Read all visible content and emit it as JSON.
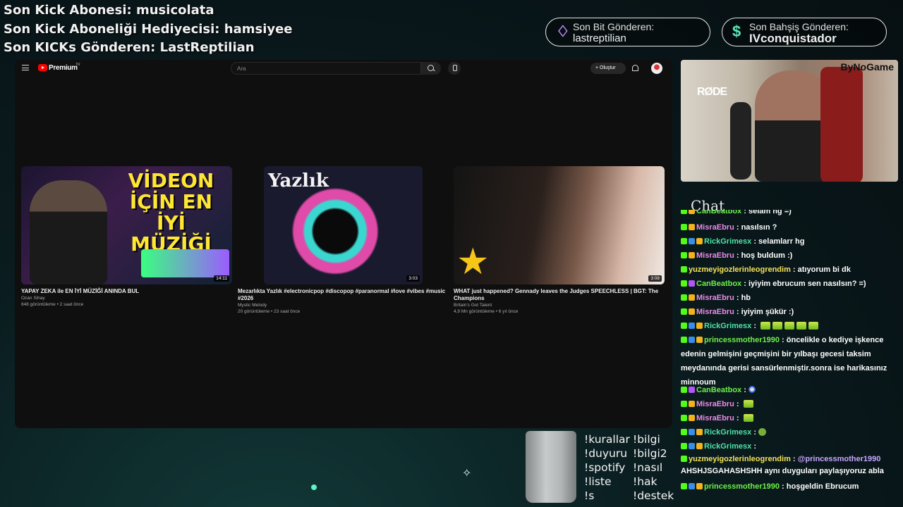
{
  "overlay": {
    "lines": [
      "Son Kick Abonesi: musicolata",
      "Son Kick Aboneliği Hediyecisi: hamsiyee",
      "Son KICKs Gönderen: LastReptilian"
    ],
    "bits": {
      "label": "Son Bit Gönderen:",
      "value": "lastreptilian",
      "icon": "♢"
    },
    "bet": {
      "label": "Son Bahşiş Gönderen:",
      "value": "IVconquistador",
      "icon": "$"
    }
  },
  "youtube": {
    "logo": "Premium",
    "logo_sup": "TR",
    "search_placeholder": "Ara",
    "create_label": "Oluştur",
    "videos": [
      {
        "title": "YAPAY ZEKA ile EN İYİ MÜZİĞİ ANINDA BUL",
        "thumb_text": "VİDEON İÇİN EN İYİ MÜZİĞİ BUL",
        "channel": "Ozan Sihay",
        "meta": "848 görüntüleme • 2 saat önce",
        "duration": "14:11"
      },
      {
        "title": "Mezarlıkta Yazlık #electronicpop #discopop #paranormal #love #vibes #music #2026",
        "thumb_text": "Yazlık",
        "channel": "Mystic Melody",
        "meta": "20 görüntüleme • 23 saat önce",
        "duration": "3:03"
      },
      {
        "title": "WHAT just happened? Gennady leaves the Judges SPEECHLESS | BGT: The Champions",
        "channel": "Britain's Got Talent",
        "meta": "4,9 Mn görüntüleme • 6 yıl önce",
        "duration": "3:08"
      }
    ]
  },
  "webcam": {
    "brand": "ByNoGame",
    "mic_brand": "RØDE"
  },
  "chat": {
    "title": "Chat",
    "messages": [
      {
        "user": "CanBeatbox",
        "text": "selam hg =)"
      },
      {
        "user": "MisraEbru",
        "text": "nasılsın ?"
      },
      {
        "user": "RickGrimesx",
        "text": "selamlarr hg"
      },
      {
        "user": "MisraEbru",
        "text": "hoş buldum :)"
      },
      {
        "user": "yuzmeyigozlerinleogrendim",
        "text": "atıyorum bi dk"
      },
      {
        "user": "CanBeatbox",
        "text": "iyiyim ebrucum sen nasılsın? =)"
      },
      {
        "user": "MisraEbru",
        "text": "hb"
      },
      {
        "user": "MisraEbru",
        "text": "iyiyim şükür :)"
      },
      {
        "user": "RickGrimesx",
        "text": ""
      },
      {
        "user": "princessmother1990",
        "text": "öncelikle o kediye işkence edenin gelmişini geçmişini bir yılbaşı gecesi taksim meydanında gerisi sansürlenmiştir.sonra ise harikasınız minnoum"
      },
      {
        "user": "CanBeatbox",
        "text": ""
      },
      {
        "user": "MisraEbru",
        "text": ""
      },
      {
        "user": "MisraEbru",
        "text": ""
      },
      {
        "user": "RickGrimesx",
        "text": ""
      },
      {
        "user": "RickGrimesx",
        "text": ""
      },
      {
        "user": "yuzmeyigozlerinleogrendim",
        "text": "AHSHJSGAHASHSHH aynı duyguları paylaşıyoruz abla",
        "mention": "@princessmother1990"
      },
      {
        "user": "princessmother1990",
        "text": "hoşgeldin Ebrucum"
      }
    ]
  },
  "commands": {
    "col1": [
      "!kurallar",
      "!duyuru",
      "!spotify",
      "!liste",
      "!s"
    ],
    "col2": [
      "!bilgi",
      "!bilgi2",
      "!nasıl",
      "!hak",
      "!destek"
    ]
  }
}
